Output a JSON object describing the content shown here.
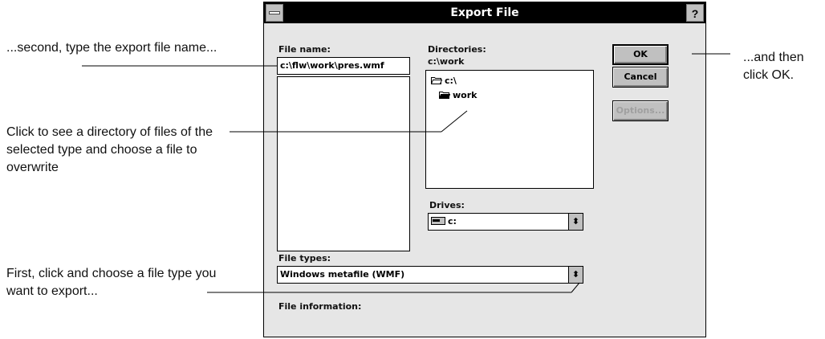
{
  "dialog": {
    "title": "Export File",
    "help_label": "?",
    "filename_label": "File name:",
    "filename_value": "c:\\flw\\work\\pres.wmf",
    "directories_label": "Directories:",
    "current_dir": "c:\\work",
    "dir_tree": [
      {
        "label": "c:\\",
        "icon": "open-folder-icon"
      },
      {
        "label": "work",
        "icon": "open-folder-icon"
      }
    ],
    "drives_label": "Drives:",
    "drive_value": "c:",
    "filetypes_label": "File types:",
    "filetype_value": "Windows metafile (WMF)",
    "fileinfo_label": "File information:",
    "buttons": {
      "ok": "OK",
      "cancel": "Cancel",
      "options": "Options..."
    }
  },
  "annotations": {
    "second": "...second, type the export file name...",
    "click_see": "Click to see a directory of files of the selected type and choose a file to overwrite",
    "first": "First, click and choose a file type you want to export...",
    "then": "...and then click OK."
  }
}
